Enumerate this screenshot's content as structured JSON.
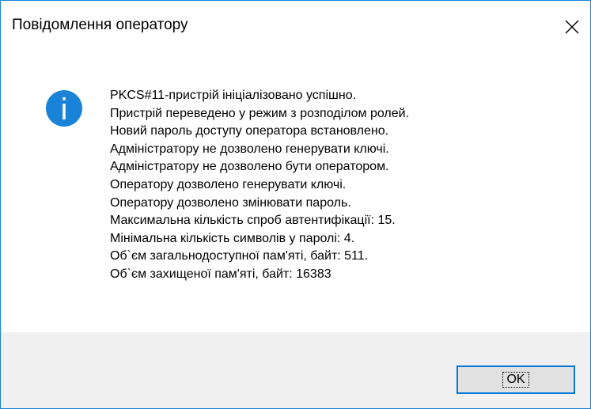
{
  "window": {
    "title": "Повідомлення оператору",
    "close_icon": "close-icon"
  },
  "message": {
    "icon": "info-icon",
    "icon_color": "#1883d7",
    "lines": [
      "PKCS#11-пристрій ініціалізовано успішно.",
      "Пристрій переведено у режим з розподілом ролей.",
      "Новий пароль доступу оператора встановлено.",
      "Адміністратору не дозволено генерувати ключі.",
      "Адміністратору не дозволено бути оператором.",
      "Оператору дозволено генерувати ключі.",
      "Оператору дозволено змінювати пароль.",
      "Максимальна кількість спроб автентифікації: 15.",
      "Мінімальна кількість символів у паролі: 4.",
      "Об`єм загальнодоступної пам'яті, байт: 511.",
      "Об`єм захищеної пам'яті, байт: 16383"
    ]
  },
  "footer": {
    "ok_label": "OK"
  },
  "colors": {
    "accent": "#0078d7",
    "border": "#1883d7",
    "footer_bg": "#f0f0f0",
    "button_bg": "#e1e1e1"
  }
}
